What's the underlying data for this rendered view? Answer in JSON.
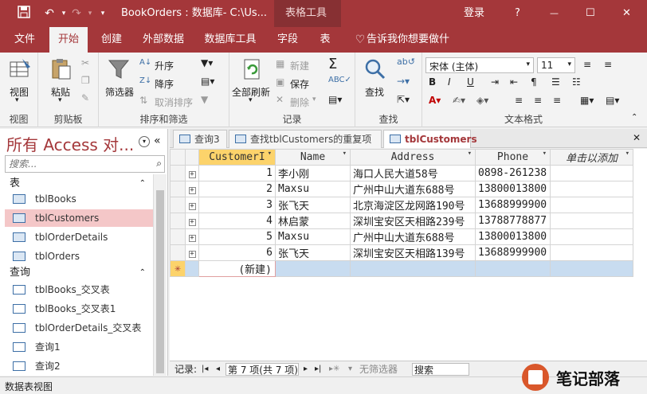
{
  "titlebar": {
    "doc_title": "BookOrders : 数据库- C:\\Us...",
    "context_tab": "表格工具",
    "login": "登录",
    "help": "?",
    "minimize": "—",
    "maximize": "☐",
    "close": "✕"
  },
  "tabs": [
    "文件",
    "开始",
    "创建",
    "外部数据",
    "数据库工具",
    "字段",
    "表",
    "告诉我你想要做什么"
  ],
  "ribbon": {
    "view": "视图",
    "paste": "粘贴",
    "filter": "筛选器",
    "asc": "升序",
    "desc": "降序",
    "clear_sort": "取消排序",
    "refresh_all": "全部刷新",
    "new": "新建",
    "save": "保存",
    "delete": "删除",
    "find": "查找",
    "font_name": "宋体 (主体)",
    "font_size": "11",
    "groups": {
      "view": "视图",
      "clipboard": "剪贴板",
      "sort_filter": "排序和筛选",
      "records": "记录",
      "find": "查找",
      "text_format": "文本格式"
    }
  },
  "nav": {
    "title": "所有 Access 对...",
    "search_placeholder": "搜索...",
    "section_tables": "表",
    "section_queries": "查询",
    "tables": [
      "tblBooks",
      "tblCustomers",
      "tblOrderDetails",
      "tblOrders"
    ],
    "queries": [
      "tblBooks_交叉表",
      "tblBooks_交叉表1",
      "tblOrderDetails_交叉表",
      "查询1",
      "查询2"
    ]
  },
  "doctabs": [
    "查询3",
    "查找tblCustomers的重复项",
    "tblCustomers"
  ],
  "sheet": {
    "columns": [
      "CustomerI",
      "Name",
      "Address",
      "Phone",
      "单击以添加"
    ],
    "rows": [
      [
        "1",
        "李小刚",
        "海口人民大道58号",
        "0898-261238"
      ],
      [
        "2",
        "Maxsu",
        "广州中山大道东688号",
        "13800013800"
      ],
      [
        "3",
        "张飞天",
        "北京海淀区龙网路190号",
        "13688999900"
      ],
      [
        "4",
        "林启蒙",
        "深圳宝安区天相路239号",
        "13788778877"
      ],
      [
        "5",
        "Maxsu",
        "广州中山大道东688号",
        "13800013800"
      ],
      [
        "6",
        "张飞天",
        "深圳宝安区天相路139号",
        "13688999900"
      ]
    ],
    "new_row_marker": "✳",
    "new_label": "(新建)"
  },
  "recnav": {
    "label": "记录:",
    "position": "第 7 项(共 7 项)",
    "filter": "无筛选器",
    "search": "搜索"
  },
  "status": "数据表视图",
  "watermark": "笔记部落"
}
